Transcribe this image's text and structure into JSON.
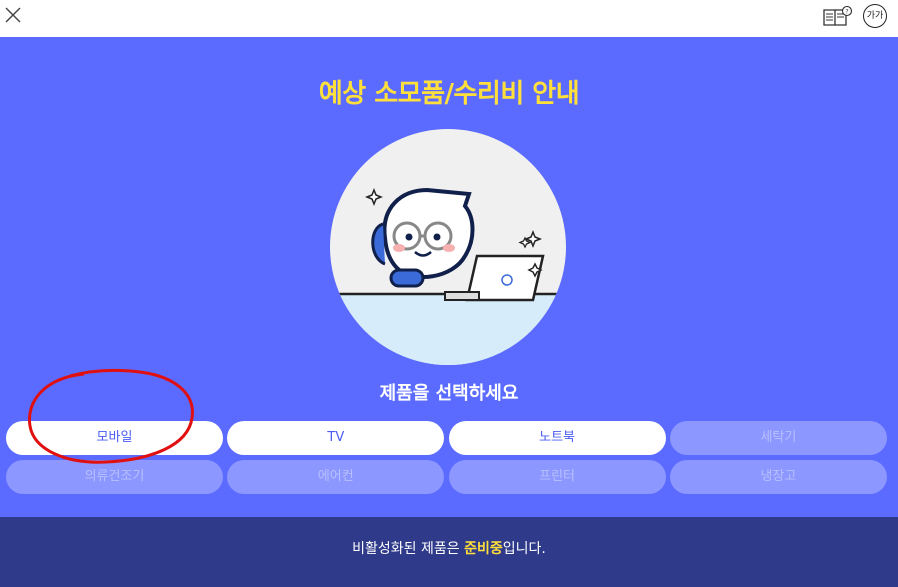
{
  "topbar": {
    "close_icon": "close-icon",
    "guide_icon": "book-guide-icon",
    "font_size_label": "가가"
  },
  "main": {
    "title": "예상 소모품/수리비 안내",
    "prompt": "제품을 선택하세요",
    "products": [
      {
        "label": "모바일",
        "enabled": true
      },
      {
        "label": "TV",
        "enabled": true
      },
      {
        "label": "노트북",
        "enabled": true
      },
      {
        "label": "세탁기",
        "enabled": false
      },
      {
        "label": "의류건조기",
        "enabled": false
      },
      {
        "label": "에어컨",
        "enabled": false
      },
      {
        "label": "프린터",
        "enabled": false
      },
      {
        "label": "냉장고",
        "enabled": false
      }
    ]
  },
  "footer": {
    "notice_prefix": "비활성화된 제품은 ",
    "notice_highlight": "준비중",
    "notice_suffix": "입니다."
  },
  "colors": {
    "background": "#5b6bff",
    "title": "#ffe03a",
    "footer_bg": "#2f3a8a",
    "active_button": "#ffffff",
    "inactive_button": "#8c97ff",
    "annotation": "#e01010"
  }
}
